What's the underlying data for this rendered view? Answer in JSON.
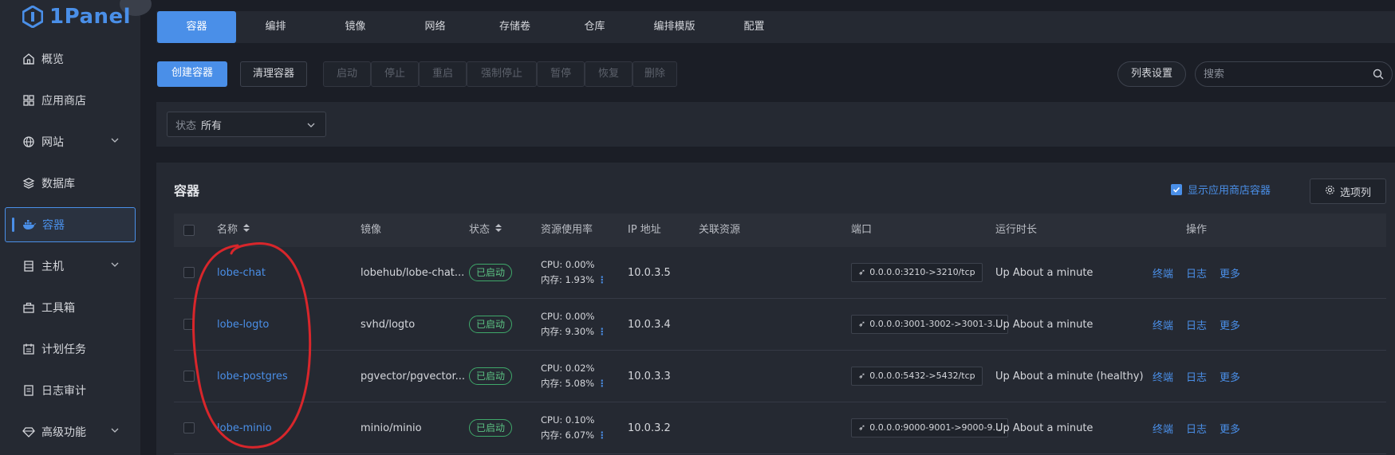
{
  "app": {
    "logo_text": "1Panel"
  },
  "sidebar": {
    "items": [
      {
        "label": "概览",
        "icon": "home-icon"
      },
      {
        "label": "应用商店",
        "icon": "grid-icon"
      },
      {
        "label": "网站",
        "icon": "globe-icon"
      },
      {
        "label": "数据库",
        "icon": "layers-icon"
      },
      {
        "label": "容器",
        "icon": "docker-icon"
      },
      {
        "label": "主机",
        "icon": "server-icon"
      },
      {
        "label": "工具箱",
        "icon": "toolbox-icon"
      },
      {
        "label": "计划任务",
        "icon": "calendar-icon"
      },
      {
        "label": "日志审计",
        "icon": "log-icon"
      },
      {
        "label": "高级功能",
        "icon": "diamond-icon"
      }
    ]
  },
  "tabs": [
    "容器",
    "编排",
    "镜像",
    "网络",
    "存储卷",
    "仓库",
    "编排模版",
    "配置"
  ],
  "toolbar": {
    "create": "创建容器",
    "clean": "清理容器",
    "start": "启动",
    "stop": "停止",
    "restart": "重启",
    "kill": "强制停止",
    "pause": "暂停",
    "resume": "恢复",
    "delete": "删除",
    "list_settings": "列表设置",
    "search_placeholder": "搜索"
  },
  "filter": {
    "label": "状态",
    "value": "所有"
  },
  "panel": {
    "title": "容器",
    "show_store_label": "显示应用商店容器",
    "columns_button": "选项列"
  },
  "table": {
    "headers": {
      "name": "名称",
      "image": "镜像",
      "status": "状态",
      "usage": "资源使用率",
      "ip": "IP 地址",
      "related": "关联资源",
      "ports": "端口",
      "uptime": "运行时长",
      "ops": "操作"
    },
    "ops_labels": {
      "terminal": "终端",
      "logs": "日志",
      "more": "更多"
    },
    "rows": [
      {
        "name": "lobe-chat",
        "image": "lobehub/lobe-chat...",
        "status": "已启动",
        "cpu": "CPU: 0.00%",
        "mem": "内存: 1.93%",
        "ip": "10.0.3.5",
        "port": "0.0.0.0:3210->3210/tcp",
        "uptime": "Up About a minute"
      },
      {
        "name": "lobe-logto",
        "image": "svhd/logto",
        "status": "已启动",
        "cpu": "CPU: 0.00%",
        "mem": "内存: 9.30%",
        "ip": "10.0.3.4",
        "port": "0.0.0.0:3001-3002->3001-3...",
        "uptime": "Up About a minute"
      },
      {
        "name": "lobe-postgres",
        "image": "pgvector/pgvector...",
        "status": "已启动",
        "cpu": "CPU: 0.02%",
        "mem": "内存: 5.08%",
        "ip": "10.0.3.3",
        "port": "0.0.0.0:5432->5432/tcp",
        "uptime": "Up About a minute (healthy)"
      },
      {
        "name": "lobe-minio",
        "image": "minio/minio",
        "status": "已启动",
        "cpu": "CPU: 0.10%",
        "mem": "内存: 6.07%",
        "ip": "10.0.3.2",
        "port": "0.0.0.0:9000-9001->9000-9...",
        "uptime": "Up About a minute"
      }
    ]
  },
  "colors": {
    "accent": "#4a8fe8",
    "success": "#5cc283",
    "annotation": "#d8262b"
  }
}
